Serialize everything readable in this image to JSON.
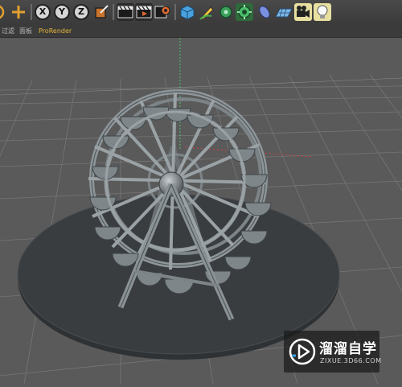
{
  "toolbar": {
    "axis_x": "X",
    "axis_y": "Y",
    "axis_z": "Z",
    "icons": [
      "add-icon",
      "axis-x-icon",
      "axis-y-icon",
      "axis-z-icon",
      "coordinate-system-icon",
      "render-view-icon",
      "render-picture-viewer-icon",
      "render-settings-icon",
      "cube-icon",
      "pen-icon",
      "subdivision-icon",
      "cloner-icon",
      "deformer-icon",
      "floor-icon",
      "camera-icon",
      "light-icon"
    ]
  },
  "menubar": {
    "filter": "过滤",
    "panel": "面板",
    "prorender": "ProRender"
  },
  "viewport": {
    "object": "ferris-wheel",
    "colors": {
      "background": "#5a5a5a",
      "grid": "#737373",
      "floor_disc": "#3a3d40",
      "model": "#8e969a"
    }
  },
  "watermark": {
    "title": "溜溜自学",
    "url": "ZIXUE.3D66.COM"
  },
  "colors": {
    "accent": "#e0a030",
    "prorender": "#e8b43a"
  }
}
